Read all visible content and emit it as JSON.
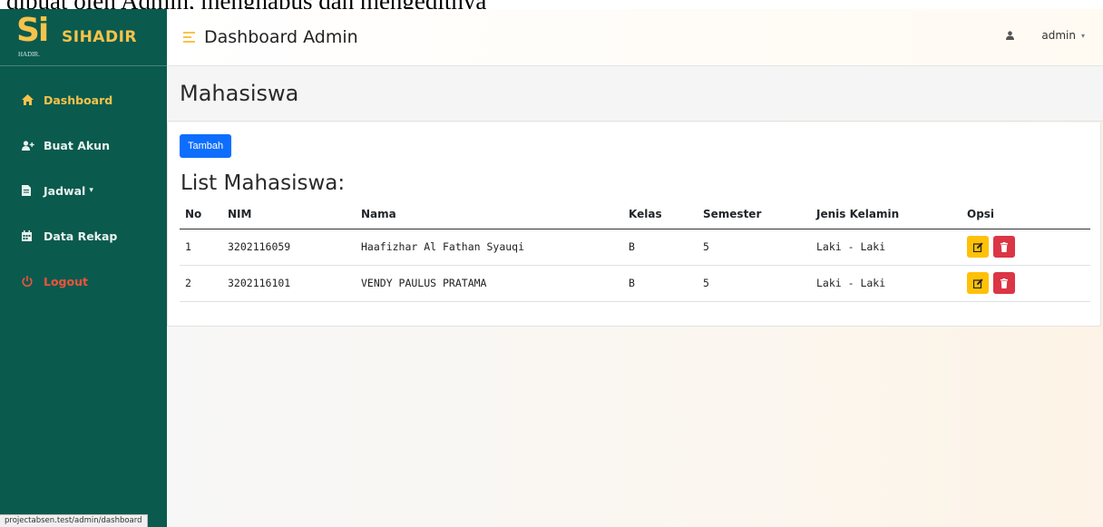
{
  "caption": "dibuat oleh Admin, menghapus dan mengeditnya",
  "sidebar": {
    "logo_text": "Si",
    "logo_sub": "HADIR.",
    "brand": "SIHADIR",
    "items": [
      {
        "label": "Dashboard",
        "icon": "home-icon",
        "active": true
      },
      {
        "label": "Buat Akun",
        "icon": "user-plus-icon"
      },
      {
        "label": "Jadwal",
        "icon": "file-icon",
        "dropdown": true
      },
      {
        "label": "Data Rekap",
        "icon": "calendar-icon"
      },
      {
        "label": "Logout",
        "icon": "power-icon"
      }
    ]
  },
  "status_bar": "projectabsen.test/admin/dashboard",
  "topbar": {
    "title": "Dashboard Admin",
    "user": "admin"
  },
  "page": {
    "title": "Mahasiswa",
    "add_button": "Tambah",
    "list_title": "List Mahasiswa:"
  },
  "table": {
    "headers": [
      "No",
      "NIM",
      "Nama",
      "Kelas",
      "Semester",
      "Jenis Kelamin",
      "Opsi"
    ],
    "rows": [
      {
        "no": "1",
        "nim": "3202116059",
        "nama": "Haafizhar Al Fathan Syauqi",
        "kelas": "B",
        "semester": "5",
        "jk": "Laki - Laki"
      },
      {
        "no": "2",
        "nim": "3202116101",
        "nama": "VENDY PAULUS PRATAMA",
        "kelas": "B",
        "semester": "5",
        "jk": "Laki - Laki"
      }
    ]
  },
  "colors": {
    "sidebar": "#0a5a4e",
    "accent": "#f6c34a",
    "primary": "#0d6efd",
    "warning": "#ffc107",
    "danger": "#dc3545"
  }
}
